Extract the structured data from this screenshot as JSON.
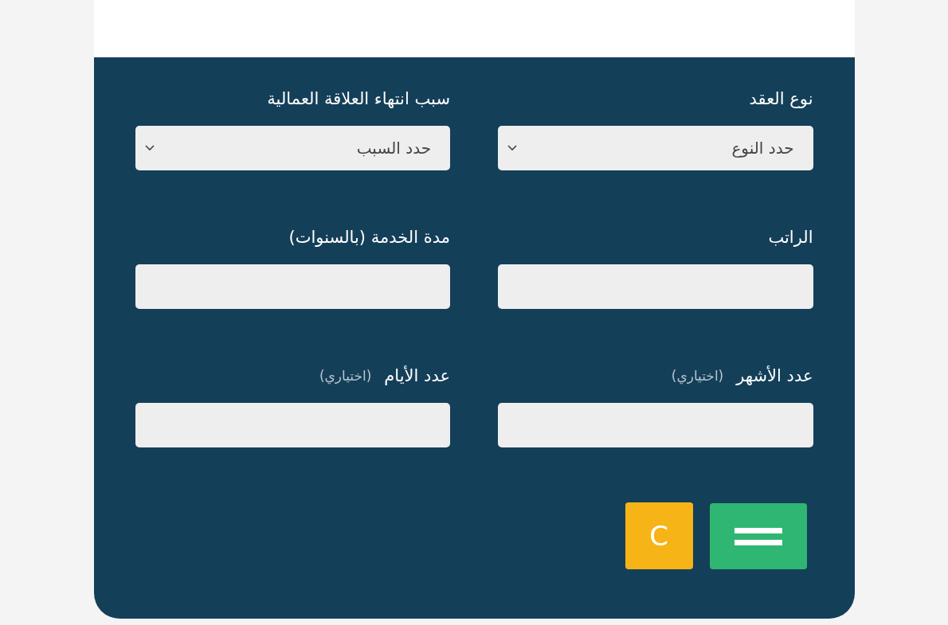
{
  "fields": [
    {
      "kind": "select",
      "label": "نوع العقد",
      "value": "حدد النوع"
    },
    {
      "kind": "select",
      "label": "سبب انتهاء العلاقة العمالية",
      "value": "حدد السبب"
    },
    {
      "kind": "input",
      "label": "الراتب"
    },
    {
      "kind": "input",
      "label": "مدة الخدمة (بالسنوات)"
    },
    {
      "kind": "input",
      "label": "عدد الأشهر",
      "note": "(اختياري)"
    },
    {
      "kind": "input",
      "label": "عدد الأيام",
      "note": "(اختياري)"
    }
  ],
  "buttons": {
    "calculate": {
      "kind": "equals"
    },
    "clear": {
      "label": "C"
    }
  }
}
